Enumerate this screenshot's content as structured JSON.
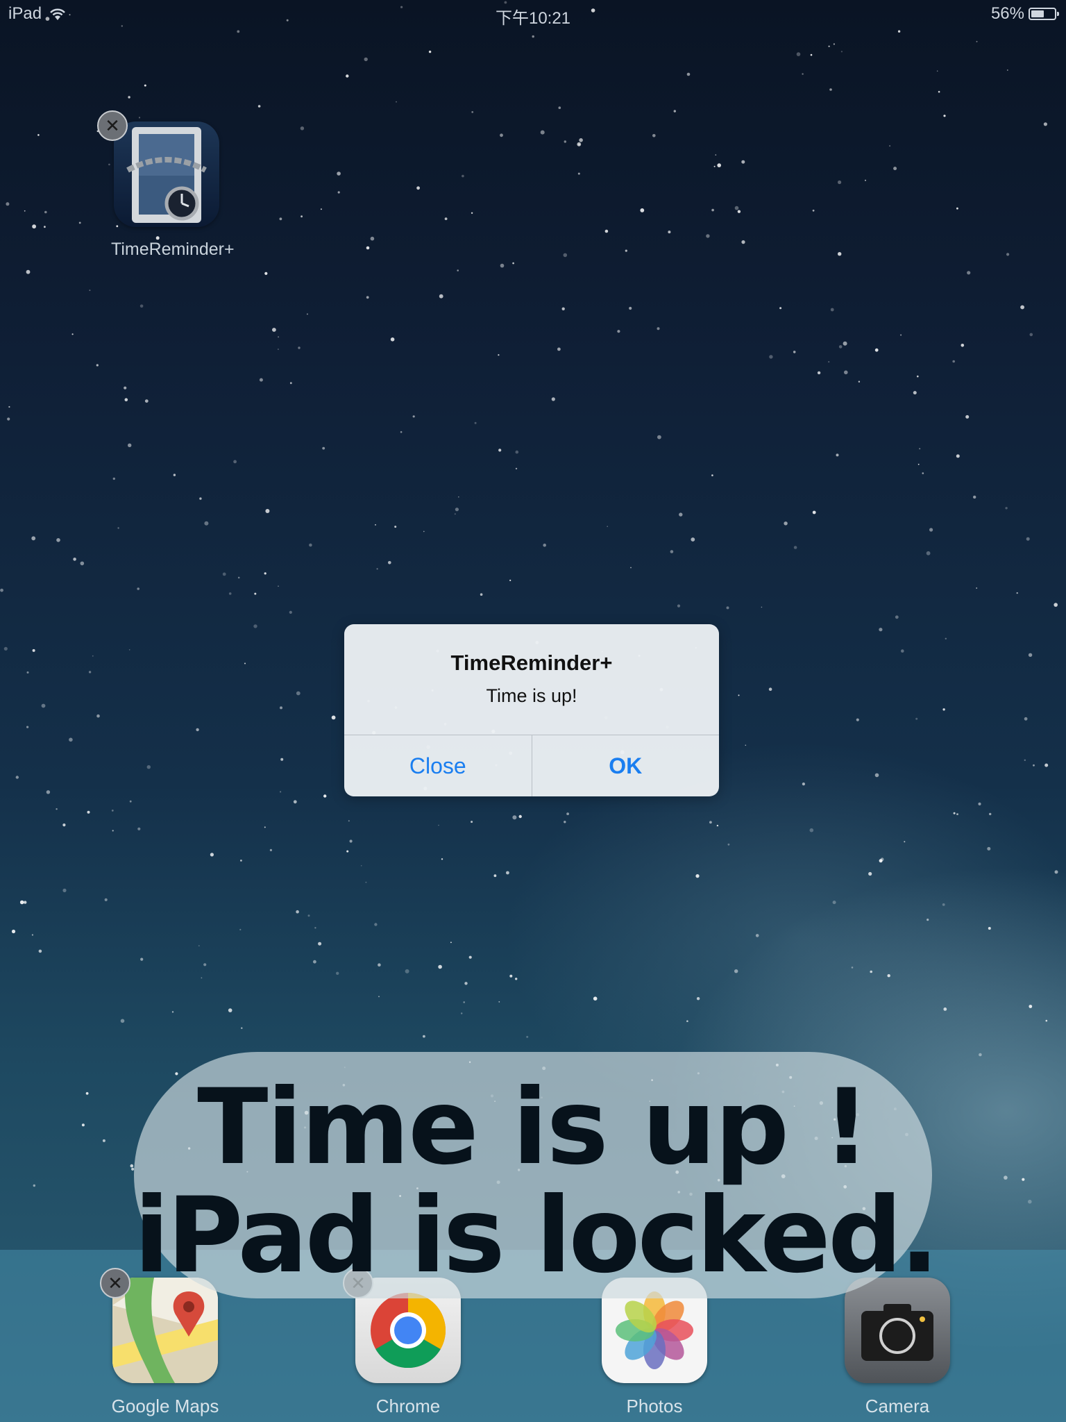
{
  "status_bar": {
    "device": "iPad",
    "time": "下午10:21",
    "battery_percent": "56%",
    "battery_level": 0.56
  },
  "home_apps": [
    {
      "label": "TimeReminder+",
      "icon": "timereminder-icon",
      "deletable": true
    }
  ],
  "alert": {
    "title": "TimeReminder+",
    "message": "Time is up!",
    "buttons": [
      {
        "label": "Close",
        "bold": false
      },
      {
        "label": "OK",
        "bold": true
      }
    ],
    "button_color": "#1a7ef0"
  },
  "banner": {
    "line1": "Time is up !",
    "line2": "iPad is locked."
  },
  "dock": {
    "apps": [
      {
        "label": "Google Maps",
        "icon": "google-maps-icon",
        "deletable": true
      },
      {
        "label": "Chrome",
        "icon": "chrome-icon",
        "deletable": true
      },
      {
        "label": "Photos",
        "icon": "photos-icon",
        "deletable": false
      },
      {
        "label": "Camera",
        "icon": "camera-icon",
        "deletable": false
      }
    ]
  }
}
